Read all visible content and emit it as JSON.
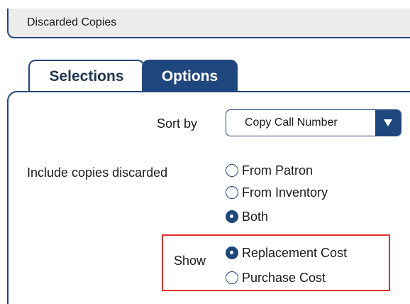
{
  "header": {
    "title": "Discarded Copies"
  },
  "tabs": [
    {
      "label": "Selections",
      "active": false
    },
    {
      "label": "Options",
      "active": true
    }
  ],
  "sort": {
    "label": "Sort by",
    "value": "Copy Call Number",
    "arrow_icon": "triangle-down-icon"
  },
  "include": {
    "label": "Include copies discarded",
    "options": [
      {
        "label": "From Patron",
        "checked": false
      },
      {
        "label": "From Inventory",
        "checked": false
      },
      {
        "label": "Both",
        "checked": true
      }
    ]
  },
  "show": {
    "label": "Show",
    "options": [
      {
        "label": "Replacement Cost",
        "checked": true
      },
      {
        "label": "Purchase Cost",
        "checked": false
      }
    ]
  },
  "colors": {
    "accent": "#20477d",
    "highlight": "#e0312b",
    "header_bg": "#ececec"
  }
}
